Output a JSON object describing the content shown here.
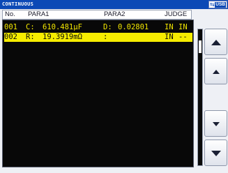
{
  "screen": {
    "title": "CONTINUOUS",
    "usb_label": "USB"
  },
  "table": {
    "columns": [
      "No.",
      "PARA1",
      "PARA2",
      "JUDGE"
    ],
    "rows": [
      {
        "no": "001",
        "p1_label": "C:",
        "p1_value": "610.481μF",
        "p2_label": "D:",
        "p2_value": "0.02801",
        "judge1": "IN",
        "judge2": "IN",
        "selected": false
      },
      {
        "no": "002",
        "p1_label": "R:",
        "p1_value": "19.3919mΩ",
        "p2_label": ":",
        "p2_value": "",
        "judge1": "IN",
        "judge2": "--",
        "selected": true
      }
    ]
  },
  "scroll_buttons": {
    "page_up": "page-up",
    "line_up": "line-up",
    "line_down": "line-down",
    "page_down": "page-down"
  },
  "colors": {
    "title_bar": "#0b49b6",
    "row_text": "#f2e600",
    "selected_row_bg": "#f6ec00",
    "table_bg": "#080808"
  }
}
